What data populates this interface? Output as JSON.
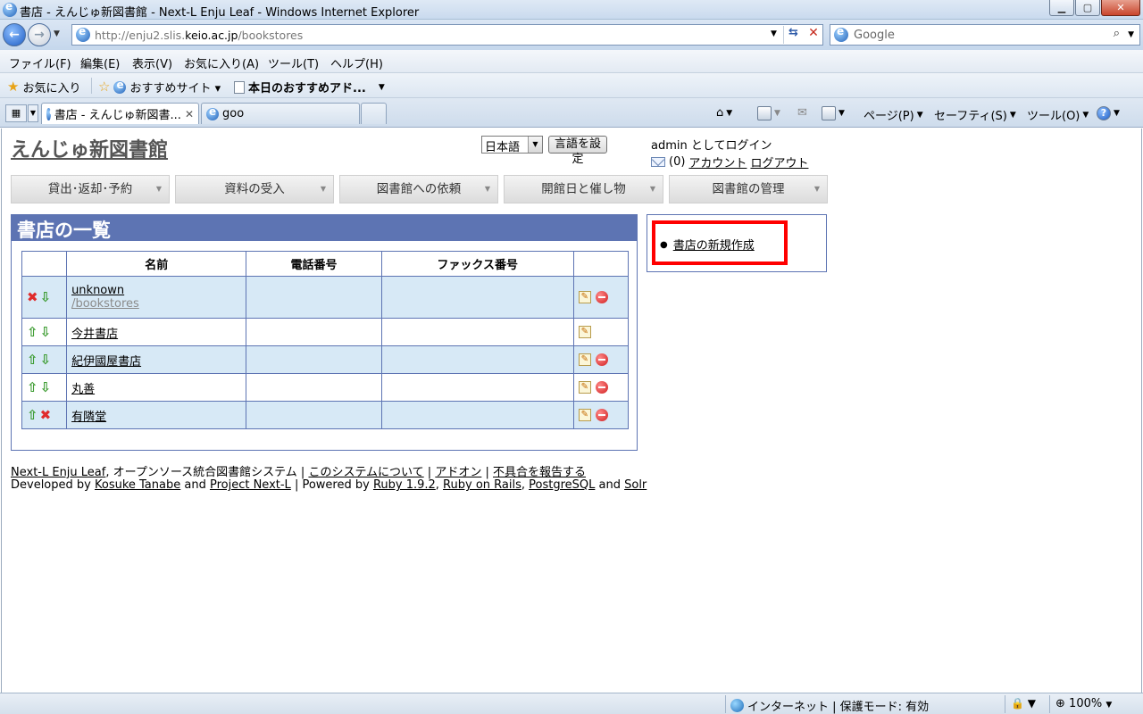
{
  "window": {
    "title": "書店 - えんじゅ新図書館 - Next-L Enju Leaf - Windows Internet Explorer"
  },
  "address": {
    "url_prefix": "http://enju2.slis.",
    "url_domain": "keio.ac.jp",
    "url_suffix": "/bookstores"
  },
  "search": {
    "placeholder": "Google"
  },
  "menu": {
    "file": "ファイル(F)",
    "edit": "編集(E)",
    "view": "表示(V)",
    "favorites": "お気に入り(A)",
    "tools": "ツール(T)",
    "help": "ヘルプ(H)"
  },
  "favbar": {
    "favorites": "お気に入り",
    "recommended": "おすすめサイト ▾",
    "today": "本日のおすすめアド..."
  },
  "tabs": {
    "active": "書店 - えんじゅ新図書...",
    "second": "goo"
  },
  "commandbar": {
    "page": "ページ(P)",
    "safety": "セーフティ(S)",
    "tools": "ツール(O)"
  },
  "site": {
    "title": "えんじゅ新図書館",
    "language": "日本語",
    "set_language": "言語を設定",
    "login_text": "admin としてログイン",
    "mail_count": "(0)",
    "account": "アカウント",
    "logout": "ログアウト"
  },
  "nav_tabs": [
    "貸出･返却･予約",
    "資料の受入",
    "図書館への依頼",
    "開館日と催し物",
    "図書館の管理"
  ],
  "main": {
    "heading": "書店の一覧",
    "columns": [
      "名前",
      "電話番号",
      "ファックス番号"
    ],
    "rows": [
      {
        "name": "unknown",
        "sub": "/bookstores"
      },
      {
        "name": "今井書店"
      },
      {
        "name": "紀伊國屋書店"
      },
      {
        "name": "丸善"
      },
      {
        "name": "有隣堂"
      }
    ]
  },
  "side": {
    "new_bookstore": "書店の新規作成"
  },
  "footer": {
    "line1": {
      "product": "Next-L Enju Leaf",
      "desc": ", オープンソース統合図書館システム ",
      "about": "このシステムについて",
      "addon": "アドオン",
      "report": "不具合を報告する"
    },
    "line2": {
      "developed_by": "Developed by ",
      "author": "Kosuke Tanabe",
      "and": " and ",
      "project": "Project Next-L",
      "powered": " | Powered by ",
      "ruby": "Ruby 1.9.2",
      "rails": "Ruby on Rails",
      "postgres": "PostgreSQL",
      "and2": " and ",
      "solr": "Solr"
    }
  },
  "status": {
    "zone": "インターネット | 保護モード: 有効",
    "zoom": "100%"
  }
}
